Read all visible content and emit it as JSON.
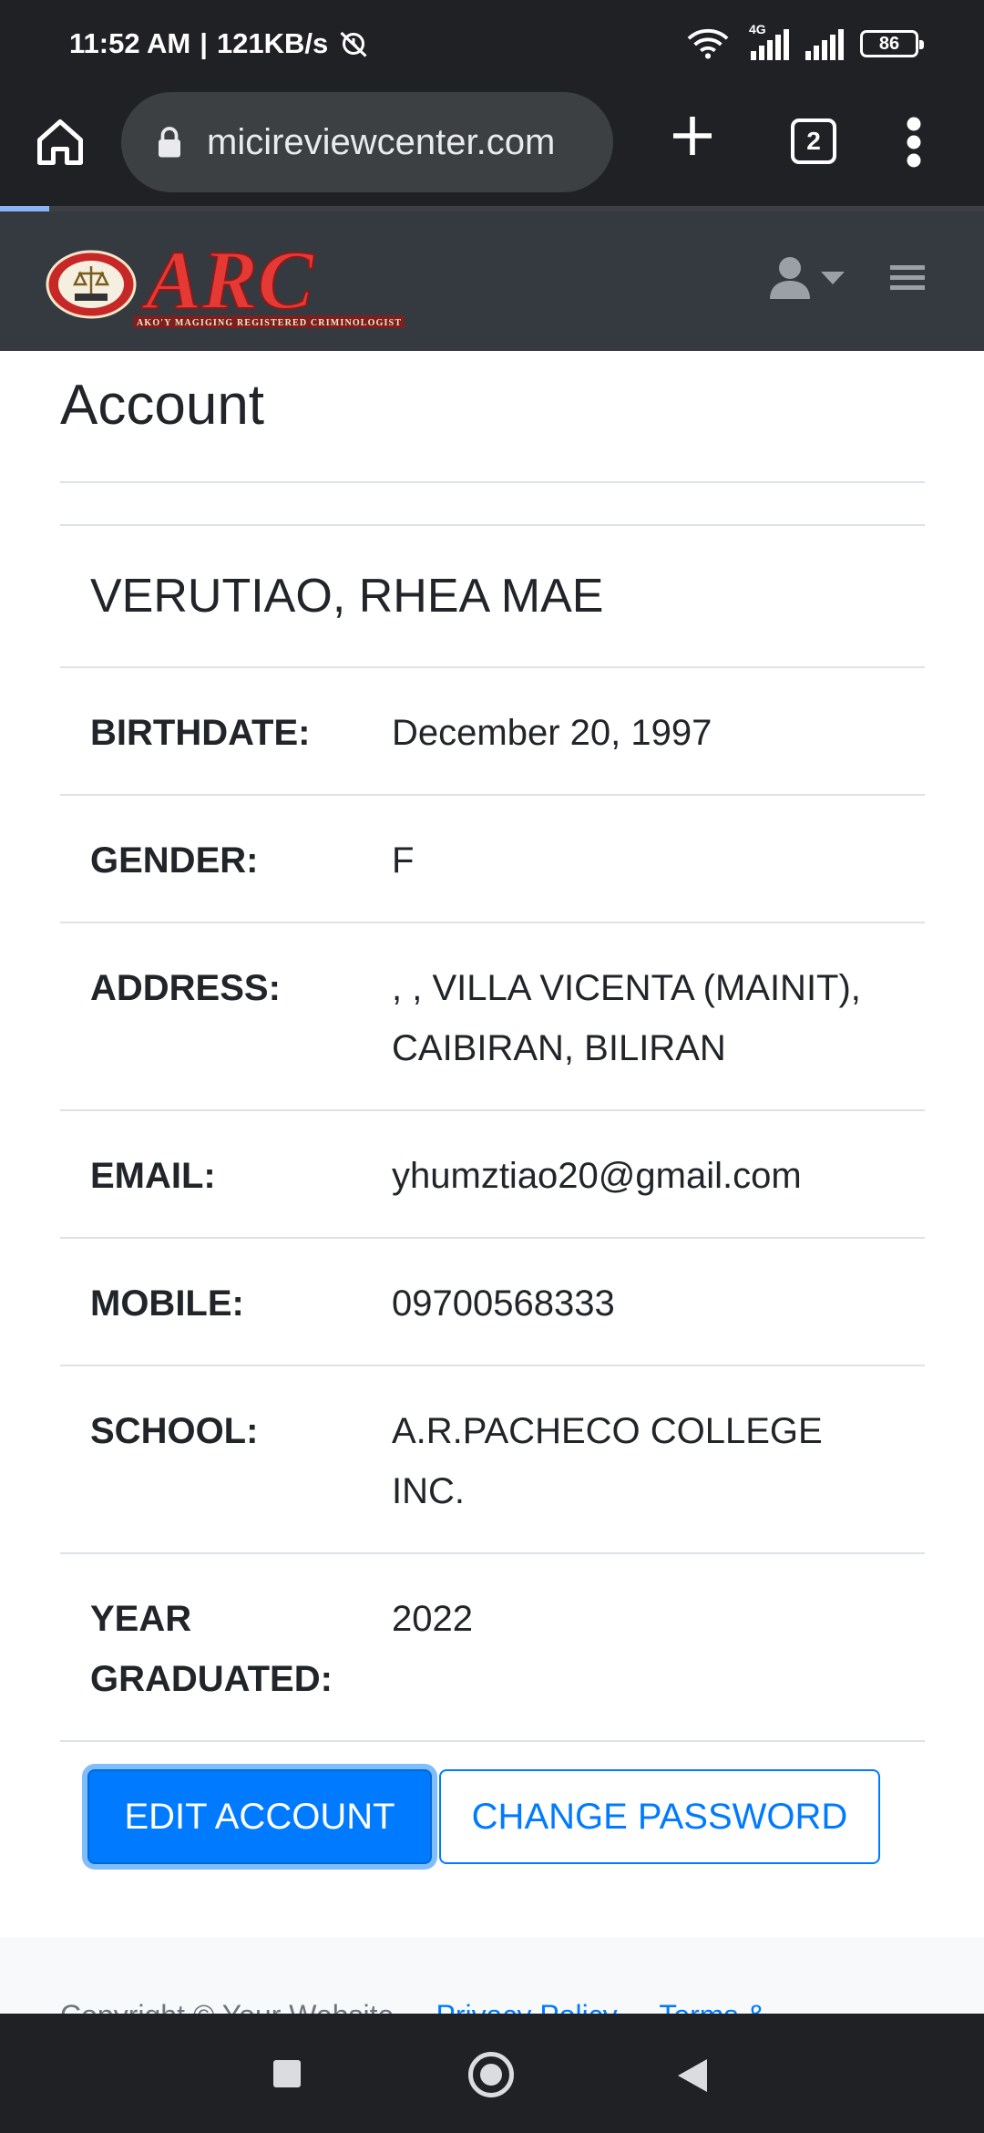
{
  "status_bar": {
    "time": "11:52 AM",
    "speed": "121KB/s",
    "network": "4G",
    "battery": "86"
  },
  "browser": {
    "url": "micireviewcenter.com",
    "tab_count": "2",
    "load_progress": 0.05
  },
  "site": {
    "logo_text": "ARC",
    "logo_tagline": "AKO'Y MAGIGING REGISTERED CRIMINOLOGIST"
  },
  "page": {
    "title": "Account",
    "full_name": "VERUTIAO, RHEA MAE"
  },
  "profile": [
    {
      "label": "BIRTHDATE:",
      "value": "December 20, 1997"
    },
    {
      "label": "GENDER:",
      "value": "F"
    },
    {
      "label": "ADDRESS:",
      "value": ", , VILLA VICENTA (MAINIT), CAIBIRAN, BILIRAN"
    },
    {
      "label": "EMAIL:",
      "value": "yhumztiao20@gmail.com"
    },
    {
      "label": "MOBILE:",
      "value": "09700568333"
    },
    {
      "label": "SCHOOL:",
      "value": "A.R.PACHECO COLLEGE INC."
    },
    {
      "label": "YEAR GRADUATED:",
      "value": "2022"
    }
  ],
  "actions": {
    "edit_label": "EDIT ACCOUNT",
    "change_password_label": "CHANGE PASSWORD"
  },
  "footer": {
    "copyright": "Copyright © Your Website",
    "privacy": "Privacy Policy",
    "terms": "Terms &"
  },
  "colors": {
    "primary": "#007bff",
    "navbar": "#343a40",
    "chrome": "#202124"
  }
}
